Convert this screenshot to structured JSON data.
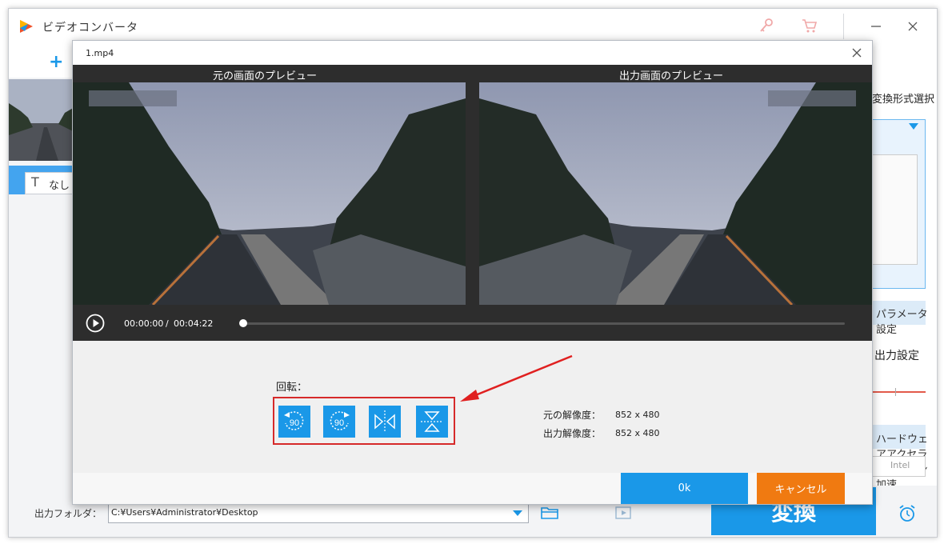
{
  "app": {
    "title": "ビデオコンバータ"
  },
  "toolbar": {
    "add_label": "+"
  },
  "left_panel": {
    "subtitle_value": "なし"
  },
  "right_panel": {
    "format_select_label": "変換形式選択",
    "param_button_label": "パラメータ設定",
    "setting2_label": "出力設定",
    "accel_button_label": "ハードウェアアクセラレーション加速",
    "accel_chip_label": "Intel"
  },
  "bottom": {
    "output_folder_label": "出力フォルダ：",
    "output_folder_value": "C:¥Users¥Administrator¥Desktop",
    "convert_label": "変換"
  },
  "modal": {
    "title": "1.mp4",
    "original_preview_label": "元の画面のプレビュー",
    "output_preview_label": "出力画面のプレビュー",
    "time_current": "00:00:00",
    "time_separator": "/",
    "time_total": "00:04:22",
    "rotate_label": "回転：",
    "rotate_buttons": [
      {
        "icon": "rotate-left-90-icon",
        "text": "90"
      },
      {
        "icon": "rotate-right-90-icon",
        "text": "90"
      },
      {
        "icon": "flip-horizontal-icon"
      },
      {
        "icon": "flip-vertical-icon"
      }
    ],
    "original_resolution_label": "元の解像度：",
    "original_resolution_value": "852 x 480",
    "output_resolution_label": "出力解像度：",
    "output_resolution_value": "852 x 480",
    "ok_label": "0k",
    "cancel_label": "キャンセル"
  },
  "colors": {
    "accent": "#1a98e8",
    "cancel": "#f07a11",
    "highlight": "#d62a2a"
  }
}
